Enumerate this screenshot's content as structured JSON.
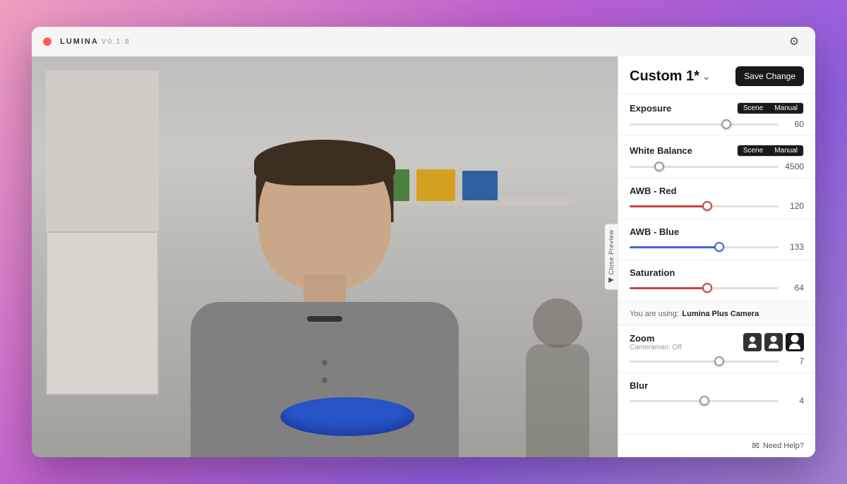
{
  "app": {
    "name": "LUMINA",
    "version": "v0.1.8"
  },
  "header": {
    "preset_name": "Custom 1*",
    "save_button": "Save Change"
  },
  "exposure": {
    "label": "Exposure",
    "scene_toggle": "Scene",
    "manual_toggle": "Manual",
    "value": 60,
    "percent": 65
  },
  "white_balance": {
    "label": "White Balance",
    "scene_toggle": "Scene",
    "manual_toggle": "Manual",
    "value": 4500,
    "percent": 20
  },
  "awb_red": {
    "label": "AWB - Red",
    "value": 120,
    "percent": 52
  },
  "awb_blue": {
    "label": "AWB - Blue",
    "value": 133,
    "percent": 60
  },
  "saturation": {
    "label": "Saturation",
    "value": 64,
    "percent": 52
  },
  "camera_info": {
    "prefix": "You are using:",
    "name": "Lumina Plus Camera"
  },
  "zoom": {
    "label": "Zoom",
    "sublabel": "Cameraman: Off",
    "value": 7,
    "percent": 60
  },
  "blur": {
    "label": "Blur",
    "value": 4,
    "percent": 50
  },
  "close_preview": {
    "label": "Close Preview"
  },
  "footer": {
    "help_label": "Need Help?"
  }
}
